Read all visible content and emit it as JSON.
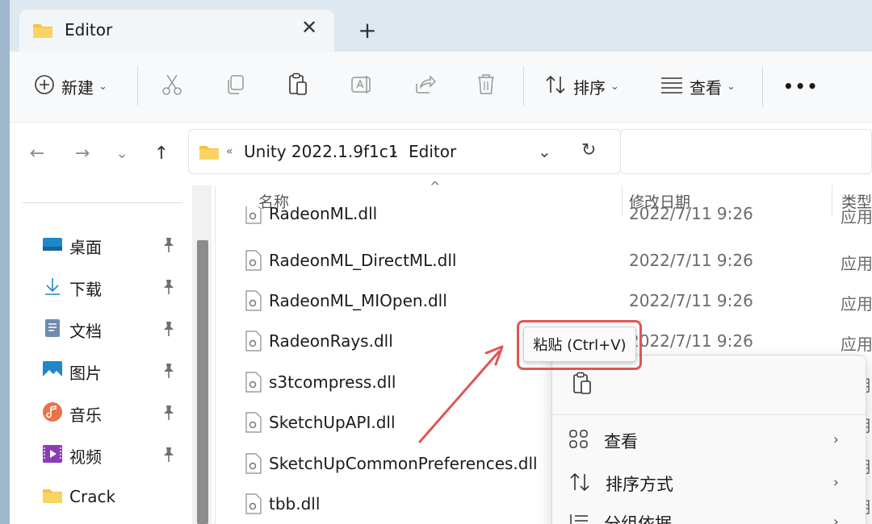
{
  "window": {
    "tab_title": "Editor",
    "tab_close_glyph": "✕",
    "new_tab_glyph": "+"
  },
  "toolbar": {
    "new_label": "新建",
    "sort_label": "排序",
    "view_label": "查看",
    "more_glyph": "•••",
    "caret": "⌄"
  },
  "address": {
    "overflow": "«",
    "crumbs": [
      "Unity 2022.1.9f1c1",
      "Editor"
    ],
    "separator": "›",
    "back_glyph": "←",
    "forward_glyph": "→",
    "recent_glyph": "⌄",
    "up_glyph": "↑",
    "dropdown_glyph": "⌄",
    "refresh_glyph": "↻"
  },
  "sidebar": {
    "items": [
      {
        "label": "桌面",
        "icon": "desktop-icon",
        "pinned": true
      },
      {
        "label": "下载",
        "icon": "download-icon",
        "pinned": true
      },
      {
        "label": "文档",
        "icon": "document-icon",
        "pinned": true
      },
      {
        "label": "图片",
        "icon": "pictures-icon",
        "pinned": true
      },
      {
        "label": "音乐",
        "icon": "music-icon",
        "pinned": true
      },
      {
        "label": "视频",
        "icon": "video-icon",
        "pinned": true
      },
      {
        "label": "Crack",
        "icon": "folder-icon",
        "pinned": false
      }
    ]
  },
  "columns": {
    "name": "名称",
    "modified": "修改日期",
    "type": "类型",
    "sort_indicator": "^"
  },
  "files": [
    {
      "name": "RadeonML.dll",
      "date": "2022/7/11 9:26",
      "type": "应用"
    },
    {
      "name": "RadeonML_DirectML.dll",
      "date": "2022/7/11 9:26",
      "type": "应用"
    },
    {
      "name": "RadeonML_MIOpen.dll",
      "date": "2022/7/11 9:26",
      "type": "应用"
    },
    {
      "name": "RadeonRays.dll",
      "date": "2022/7/11 9:26",
      "type": "应用"
    },
    {
      "name": "s3tcompress.dll",
      "date": "",
      "type": "用"
    },
    {
      "name": "SketchUpAPI.dll",
      "date": "",
      "type": "用"
    },
    {
      "name": "SketchUpCommonPreferences.dll",
      "date": "",
      "type": "用"
    },
    {
      "name": "tbb.dll",
      "date": "",
      "type": "用"
    }
  ],
  "context_menu": {
    "items": [
      {
        "label": "查看",
        "icon": "grid-view-icon"
      },
      {
        "label": "排序方式",
        "icon": "sort-icon"
      },
      {
        "label": "分组依据",
        "icon": "group-icon"
      }
    ],
    "chevron": "›"
  },
  "tooltip": {
    "text": "粘贴 (Ctrl+V)"
  },
  "colors": {
    "accent_red": "#e05555",
    "folder_yellow": "#f5c242",
    "titlebar": "#dde8f1"
  }
}
